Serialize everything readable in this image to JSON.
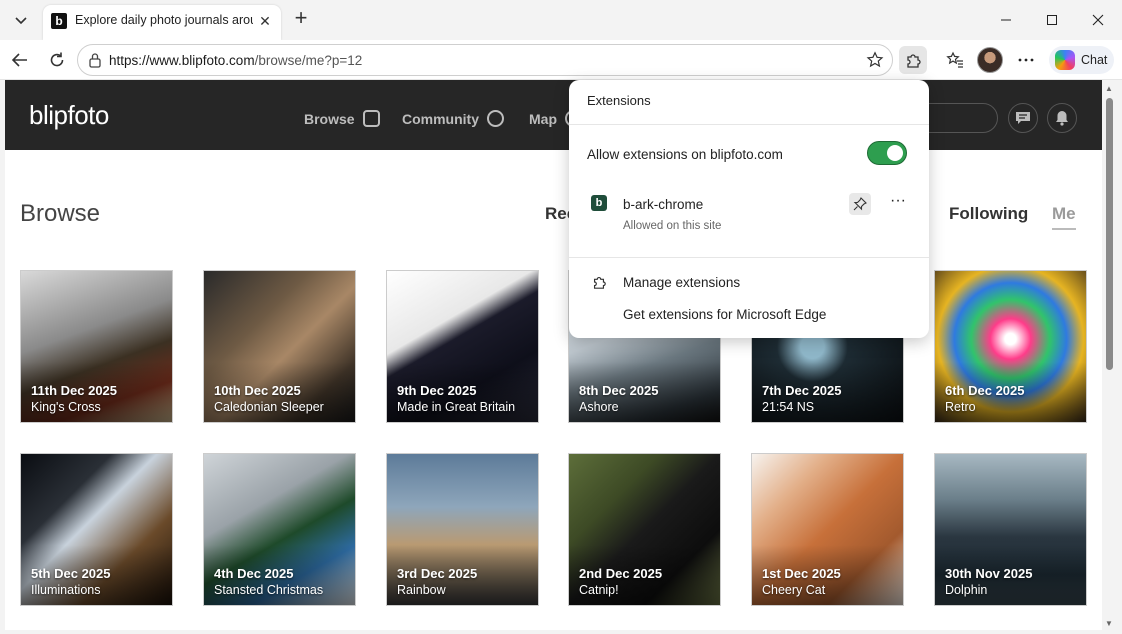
{
  "browser": {
    "tab_title": "Explore daily photo journals around the world",
    "url_host": "https://www.blipfoto.com",
    "url_path": "/browse/me?p=12",
    "chat_label": "Chat"
  },
  "site": {
    "logo": "blipfoto",
    "nav": [
      {
        "label": "Browse",
        "icon": "grid-icon"
      },
      {
        "label": "Community",
        "icon": "community-icon"
      },
      {
        "label": "Map",
        "icon": "map-icon"
      }
    ],
    "page_title": "Browse",
    "subnav": {
      "recent_partial": "Rec",
      "following": "Following",
      "me": "Me"
    }
  },
  "photos": [
    {
      "date": "11th Dec 2025",
      "caption": "King's Cross",
      "bg": "linear-gradient(160deg,#d9d9d9 0%,#8a8a8a 40%,#3b3022 60%,#6b2a1a 80%,#c9b48a 100%)"
    },
    {
      "date": "10th Dec 2025",
      "caption": "Caledonian Sleeper",
      "bg": "linear-gradient(135deg,#2a2a2a 0%,#6e5a44 35%,#a88766 55%,#403428 80%,#1a1a1a 100%)"
    },
    {
      "date": "9th Dec 2025",
      "caption": "Made in Great Britain",
      "bg": "linear-gradient(150deg,#ffffff 0%,#e8e8e8 35%,#1b1b2a 45%,#0e0f1a 70%,#2a2b3a 100%)"
    },
    {
      "date": "8th Dec 2025",
      "caption": "Ashore",
      "bg": "linear-gradient(160deg,#e9eef2 0%,#bcc5cc 40%,#6b7880 60%,#2a3238 85%,#111 100%)"
    },
    {
      "date": "7th Dec 2025",
      "caption": "21:54 NS",
      "bg": "radial-gradient(circle at 40% 50%,#8fb7c9 0 10%,#1d2b33 30%,#0b0f12 100%)"
    },
    {
      "date": "6th Dec 2025",
      "caption": "Retro",
      "bg": "radial-gradient(circle at 50% 45%,#ffffff 0 5%,#ff3c8a 18%,#31c46b 35%,#2f7ae0 50%,#e6b422 65%,#3a2a1a 100%)"
    },
    {
      "date": "5th Dec 2025",
      "caption": "Illuminations",
      "bg": "linear-gradient(135deg,#0a0d12 0%,#2a2f36 30%,#c8d2dc 45%,#6a4a2a 70%,#1a1008 100%)"
    },
    {
      "date": "4th Dec 2025",
      "caption": "Stansted Christmas",
      "bg": "linear-gradient(150deg,#cfd4d8 0%,#9aa2a8 35%,#1e4a2a 55%,#2d6aa0 75%,#dfe6ea 100%)"
    },
    {
      "date": "3rd Dec 2025",
      "caption": "Rainbow",
      "bg": "linear-gradient(180deg,#5d7b99 0%,#8ea6bb 35%,#b99a72 60%,#7a6a55 80%,#3a3a3a 100%)"
    },
    {
      "date": "2nd Dec 2025",
      "caption": "Catnip!",
      "bg": "linear-gradient(135deg,#5d6e3a 0%,#3d4a25 30%,#1a1a1a 50%,#0d0d0d 75%,#6a7444 100%)"
    },
    {
      "date": "1st Dec 2025",
      "caption": "Cheery Cat",
      "bg": "linear-gradient(135deg,#f7f3ef 0%,#e3b08a 25%,#c7703a 50%,#a35a2e 75%,#f1e6dc 100%)"
    },
    {
      "date": "30th Nov 2025",
      "caption": "Dolphin",
      "bg": "linear-gradient(180deg,#a7b8c2 0%,#6b7f8a 30%,#2a3640 55%,#1c2a33 80%,#3a4a52 100%)"
    }
  ],
  "extensions": {
    "title": "Extensions",
    "allow_label": "Allow extensions on blipfoto.com",
    "allow_on": true,
    "ext_badge": "b",
    "ext_name": "b-ark-chrome",
    "ext_status": "Allowed on this site",
    "more": "···",
    "manage": "Manage extensions",
    "get": "Get extensions for Microsoft Edge"
  },
  "colors": {
    "toggle_on": "#2e9e4f",
    "header_bg": "#262626"
  }
}
